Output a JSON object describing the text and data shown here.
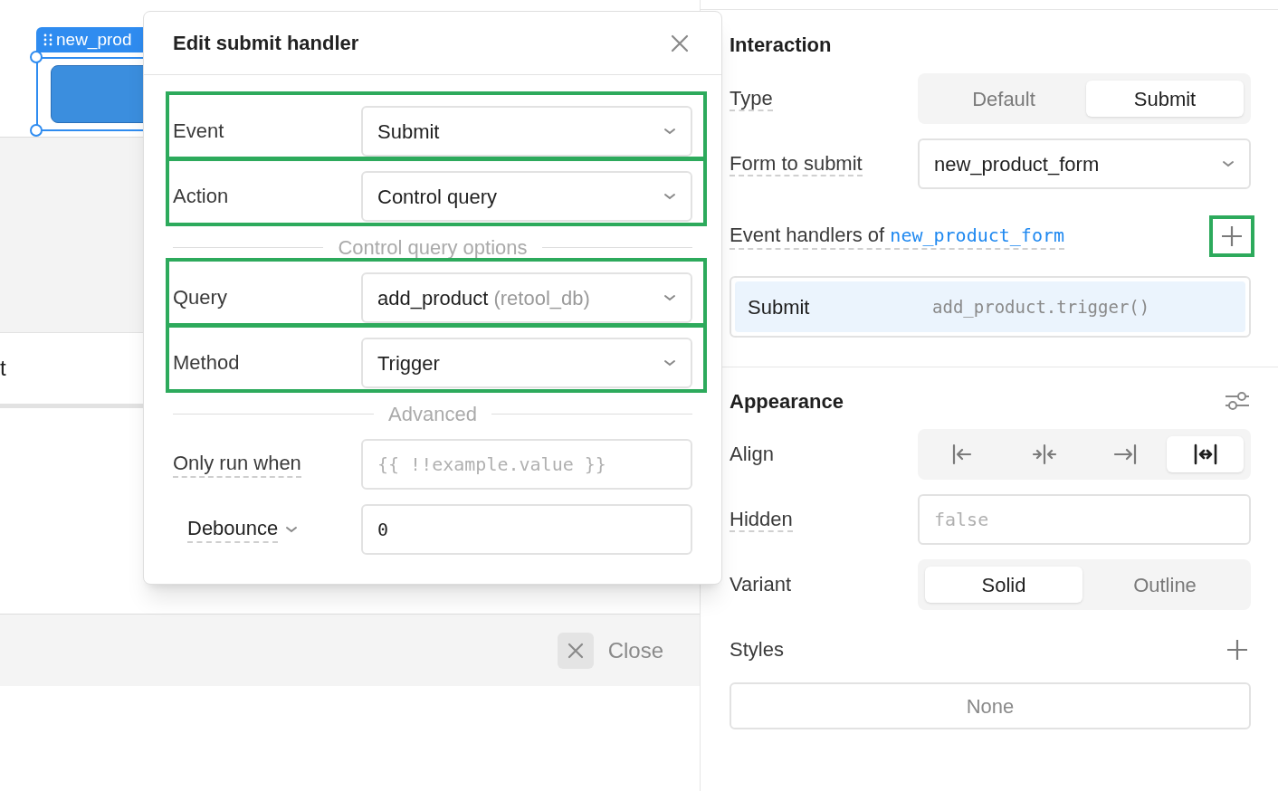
{
  "canvas": {
    "component_tag": "new_prod",
    "cell_text": "t",
    "footer_button": "Close"
  },
  "modal": {
    "title": "Edit submit handler",
    "fields": [
      {
        "kind": "select",
        "label": "Event",
        "value": "Submit",
        "highlighted": true
      },
      {
        "kind": "select",
        "label": "Action",
        "value": "Control query",
        "highlighted": true
      },
      {
        "kind": "divider",
        "label": "Control query options"
      },
      {
        "kind": "select",
        "label": "Query",
        "value": "add_product",
        "value_note": "(retool_db)",
        "highlighted": true
      },
      {
        "kind": "select",
        "label": "Method",
        "value": "Trigger",
        "highlighted": true
      },
      {
        "kind": "divider",
        "label": "Advanced"
      },
      {
        "kind": "input",
        "label": "Only run when",
        "placeholder": "{{ !!example.value }}",
        "highlighted": false
      },
      {
        "kind": "dropdown_input",
        "label": "Debounce",
        "value": "0",
        "highlighted": false
      }
    ]
  },
  "inspector": {
    "interaction": {
      "title": "Interaction",
      "type": {
        "label": "Type",
        "options": [
          {
            "label": "Default",
            "selected": false
          },
          {
            "label": "Submit",
            "selected": true
          }
        ]
      },
      "form": {
        "label": "Form to submit",
        "value": "new_product_form"
      },
      "handlers": {
        "label": "Event handlers of",
        "link": "new_product_form",
        "add_highlighted": true,
        "items": [
          {
            "event": "Submit",
            "action": "add_product.trigger()"
          }
        ]
      }
    },
    "appearance": {
      "title": "Appearance",
      "align": {
        "label": "Align",
        "options": [
          {
            "kind": "left",
            "selected": false
          },
          {
            "kind": "center",
            "selected": false
          },
          {
            "kind": "right",
            "selected": false
          },
          {
            "kind": "stretch",
            "selected": true
          }
        ]
      },
      "hidden": {
        "label": "Hidden",
        "placeholder": "false"
      },
      "variant": {
        "label": "Variant",
        "options": [
          {
            "label": "Solid",
            "selected": true
          },
          {
            "label": "Outline",
            "selected": false
          }
        ]
      },
      "styles": {
        "label": "Styles",
        "placeholder": "None"
      }
    }
  }
}
